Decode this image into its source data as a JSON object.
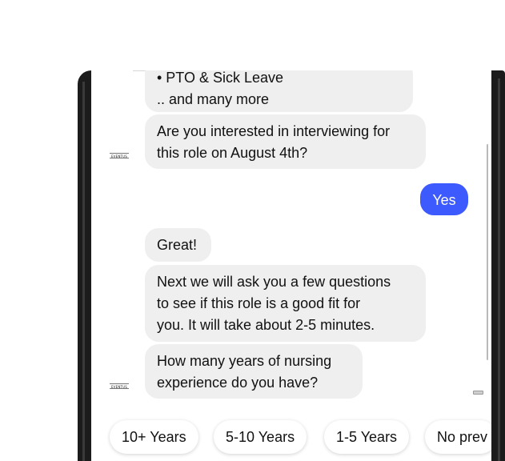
{
  "chat": {
    "messages": [
      {
        "from": "bot",
        "text": "• PTO & Sick Leave\n.. and many more"
      },
      {
        "from": "bot",
        "text": "Are you interested in interviewing for\nthis role on August 4th?"
      },
      {
        "from": "user",
        "text": "Yes"
      },
      {
        "from": "bot",
        "text": "Great!"
      },
      {
        "from": "bot",
        "text": "Next we will ask you a few questions\nto see if this role is a good fit for\nyou. It will take about 2-5 minutes."
      },
      {
        "from": "bot",
        "text": "How many years of nursing\nexperience do you have?"
      }
    ],
    "bot_logo_text": "EVENTUS"
  },
  "quick_replies": [
    "10+ Years",
    "5-10 Years",
    "1-5 Years",
    "No prev"
  ],
  "colors": {
    "user_bubble": "#3d5afe",
    "bot_bubble": "#efefef",
    "frame": "#1c1c1c"
  }
}
